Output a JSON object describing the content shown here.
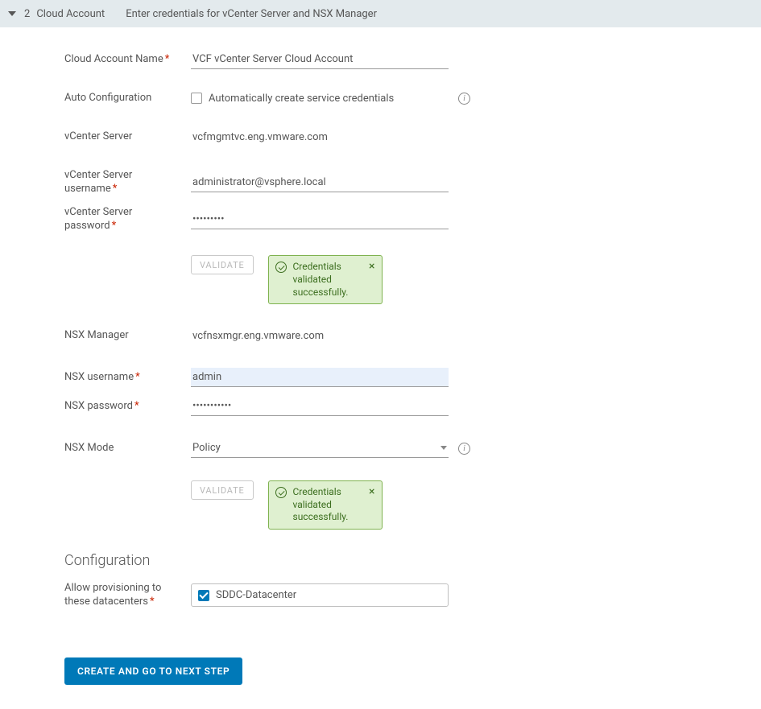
{
  "header": {
    "stepNum": "2",
    "stepTitle": "Cloud Account",
    "subtitle": "Enter credentials for vCenter Server and NSX Manager"
  },
  "labels": {
    "cloudAccountName": "Cloud Account Name",
    "autoConfig": "Auto Configuration",
    "autoConfigCheckbox": "Automatically create service credentials",
    "vcenterServer": "vCenter Server",
    "vcenterUser": "vCenter Server username",
    "vcenterPass": "vCenter Server password",
    "validate": "VALIDATE",
    "nsxManager": "NSX Manager",
    "nsxUser": "NSX username",
    "nsxPass": "NSX password",
    "nsxMode": "NSX Mode",
    "configSection": "Configuration",
    "allowProvisioning": "Allow provisioning to these datacenters",
    "primaryButton": "CREATE AND GO TO NEXT STEP"
  },
  "values": {
    "cloudAccountName": "VCF vCenter Server Cloud Account",
    "vcenterServer": "vcfmgmtvc.eng.vmware.com",
    "vcenterUser": "administrator@vsphere.local",
    "vcenterPass": "•••••••••",
    "nsxManager": "vcfnsxmgr.eng.vmware.com",
    "nsxUser": "admin",
    "nsxPass": "•••••••••••",
    "nsxMode": "Policy",
    "datacenter": "SDDC-Datacenter"
  },
  "toast": {
    "message": "Credentials validated successfully."
  }
}
